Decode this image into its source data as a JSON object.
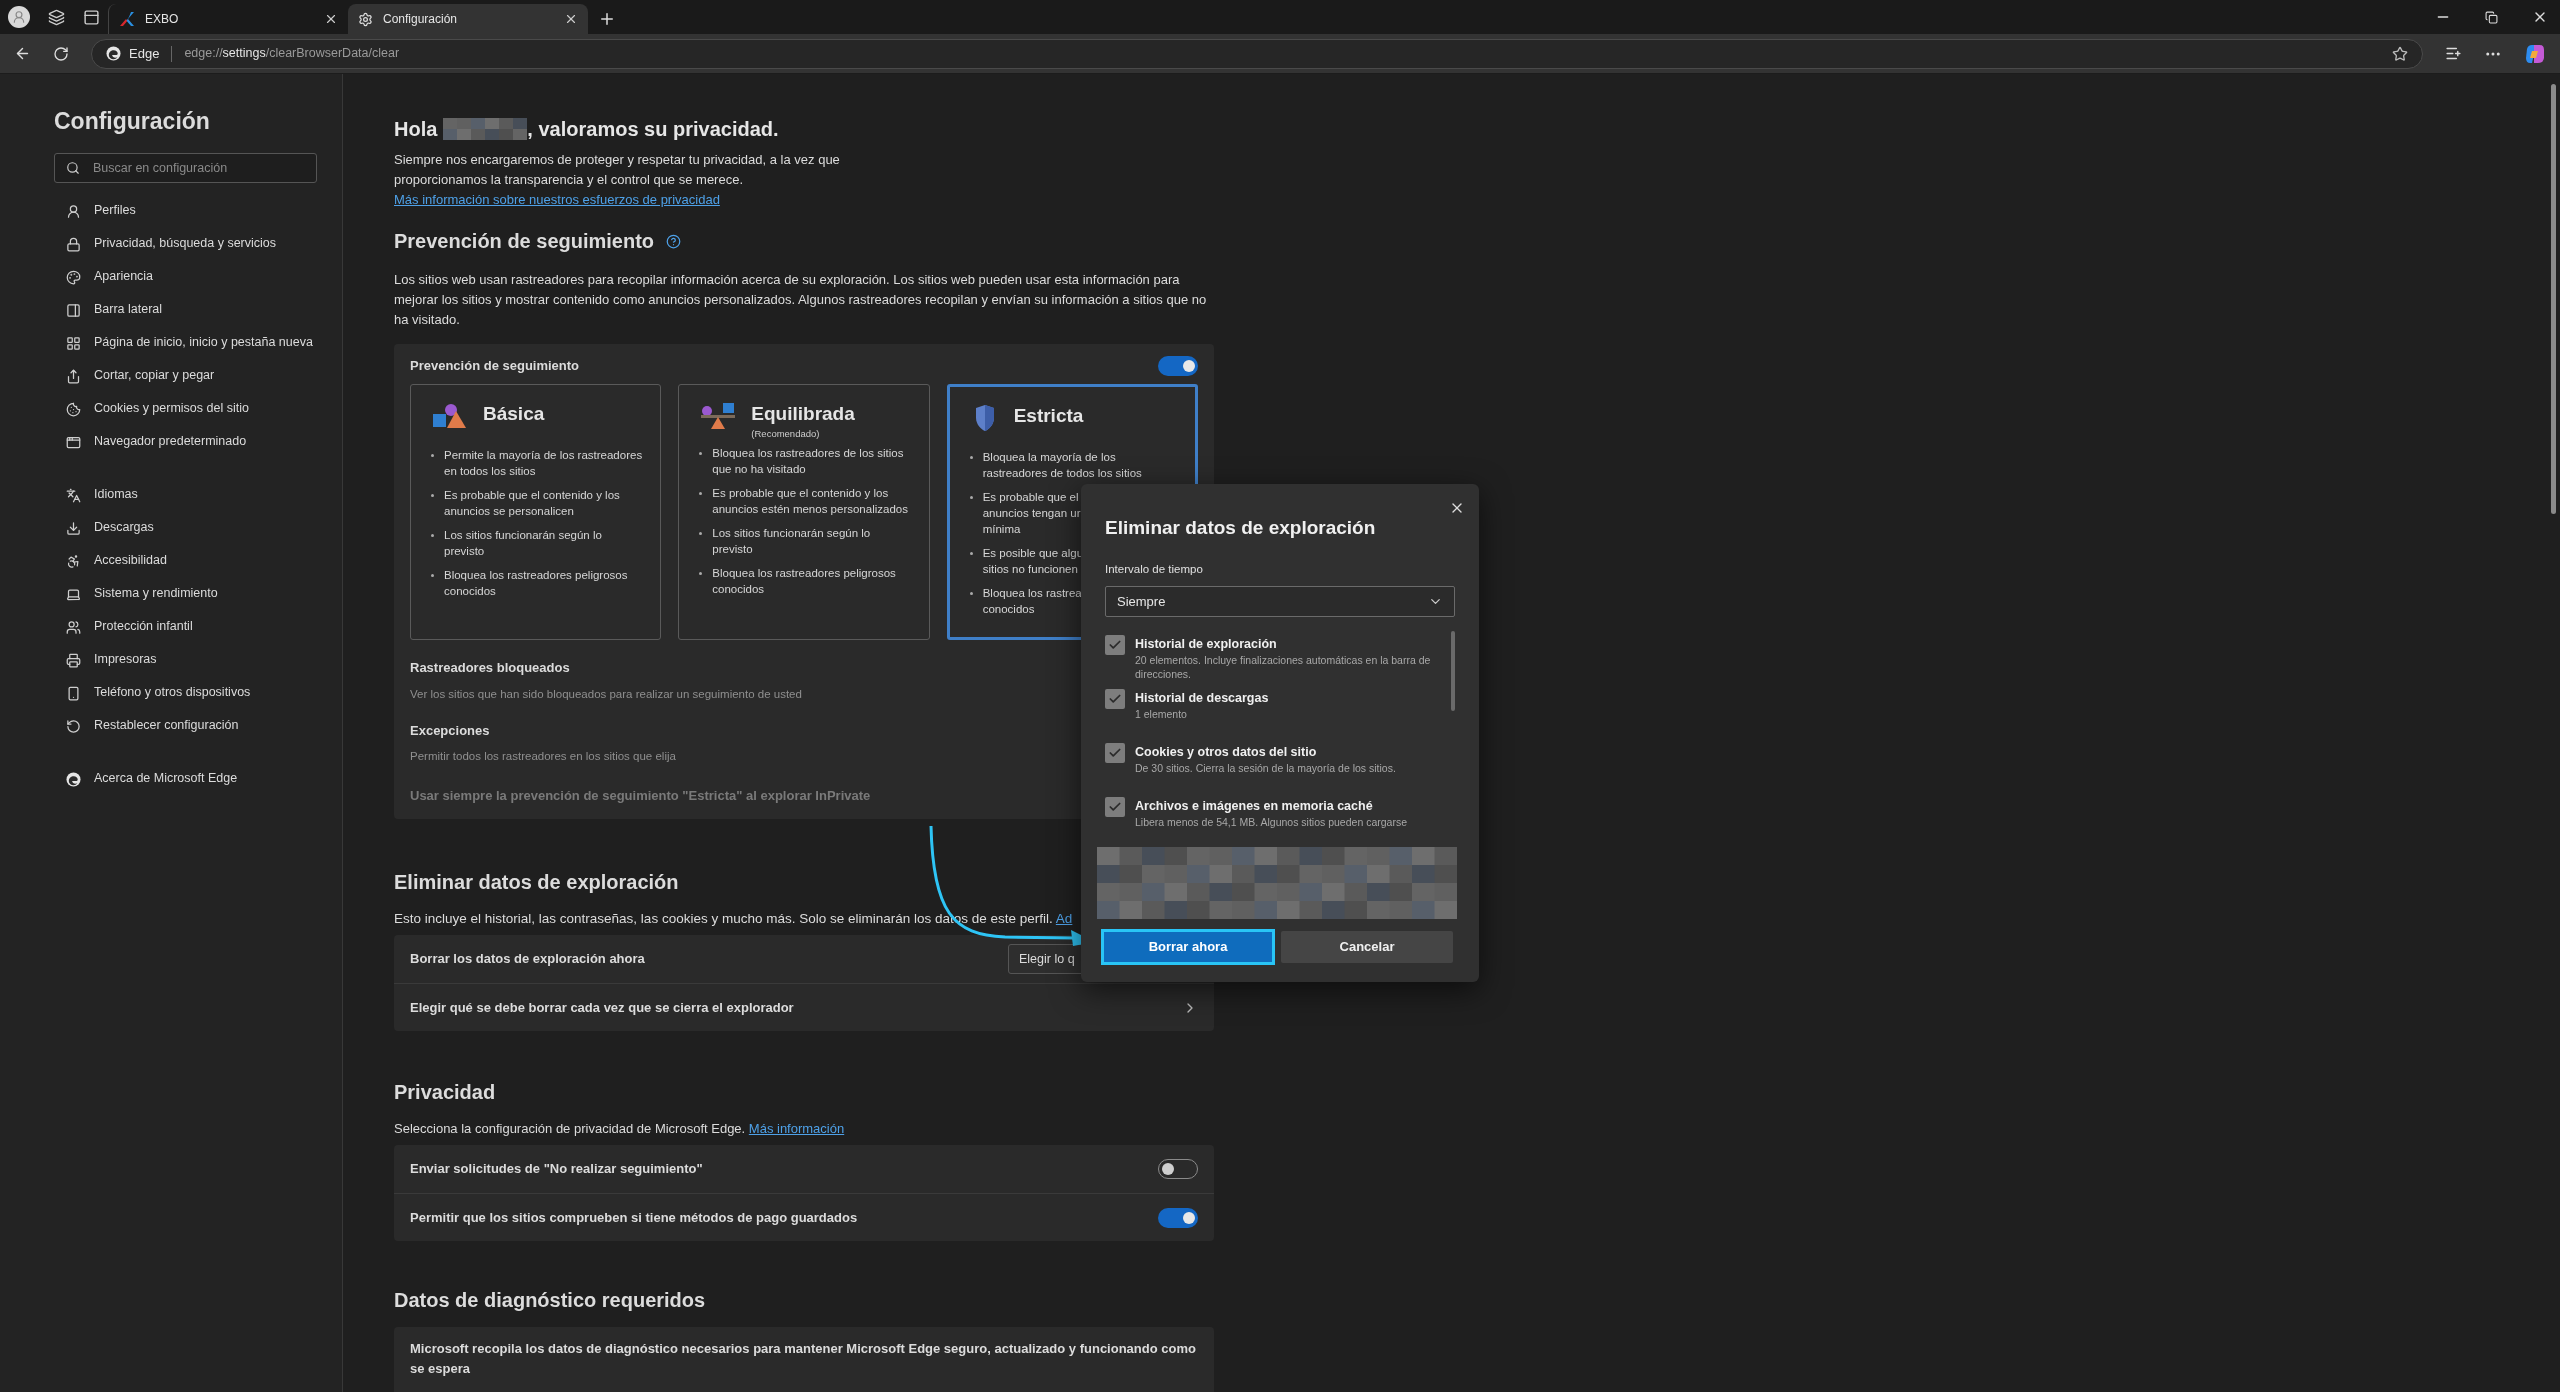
{
  "browser": {
    "tabs": [
      {
        "title": "EXBO",
        "selected": false
      },
      {
        "title": "Configuración",
        "selected": true
      }
    ],
    "address": {
      "label": "Edge",
      "scheme": "edge://",
      "host": "settings",
      "path": "/clearBrowserData/clear"
    }
  },
  "sidebar": {
    "title": "Configuración",
    "search": {
      "placeholder": "Buscar en configuración"
    },
    "groups": [
      [
        "Perfiles",
        "Privacidad, búsqueda y servicios",
        "Apariencia",
        "Barra lateral",
        "Página de inicio, inicio y pestaña nueva",
        "Cortar, copiar y pegar",
        "Cookies y permisos del sitio",
        "Navegador predeterminado"
      ],
      [
        "Idiomas",
        "Descargas",
        "Accesibilidad",
        "Sistema y rendimiento",
        "Protección infantil",
        "Impresoras",
        "Teléfono y otros dispositivos",
        "Restablecer configuración"
      ],
      [
        "Acerca de Microsoft Edge"
      ]
    ]
  },
  "greeting": {
    "before": "Hola",
    "after": ", valoramos su privacidad.",
    "text": "Siempre nos encargaremos de proteger y respetar tu privacidad, a la vez que proporcionamos la transparencia y el control que se merece.",
    "link": "Más información sobre nuestros esfuerzos de privacidad"
  },
  "tracking": {
    "title": "Prevención de seguimiento",
    "description": "Los sitios web usan rastreadores para recopilar información acerca de su exploración. Los sitios web pueden usar esta información para mejorar los sitios y mostrar contenido como anuncios personalizados. Algunos rastreadores recopilan y envían su información a sitios que no ha visitado.",
    "panel_label": "Prevención de seguimiento",
    "on": true,
    "levels": [
      {
        "name": "Básica",
        "selected": false,
        "bullets": [
          [
            "Permite la mayoría de los rastreadores",
            "en todos los sitios"
          ],
          [
            "Es probable que el contenido y los",
            "anuncios se personalicen"
          ],
          [
            "Los sitios funcionarán según lo",
            "previsto"
          ],
          [
            "Bloquea los rastreadores peligrosos",
            "conocidos"
          ]
        ]
      },
      {
        "name": "Equilibrada",
        "note": "(Recomendado)",
        "selected": false,
        "bullets": [
          [
            "Bloquea los rastreadores de los sitios",
            "que no ha visitado"
          ],
          [
            "Es probable que el contenido y los",
            "anuncios estén menos personalizados"
          ],
          [
            "Los sitios funcionarán según lo",
            "previsto"
          ],
          [
            "Bloquea los rastreadores peligrosos",
            "conocidos"
          ]
        ]
      },
      {
        "name": "Estricta",
        "selected": true,
        "bullets": [
          [
            "Bloquea la mayoría de los",
            "rastreadores de todos los sitios"
          ],
          [
            "Es probable que el",
            "anuncios tengan ur",
            "mínima"
          ],
          [
            "Es posible que algu",
            "sitios no funcionen"
          ],
          [
            "Bloquea los rastrea",
            "conocidos"
          ]
        ]
      }
    ],
    "blocked": {
      "title": "Rastreadores bloqueados",
      "subtitle": "Ver los sitios que han sido bloqueados para realizar un seguimiento de usted"
    },
    "exceptions": {
      "title": "Excepciones",
      "subtitle": "Permitir todos los rastreadores en los sitios que elija"
    },
    "inprivate": "Usar siempre la prevención de seguimiento \"Estricta\" al explorar InPrivate"
  },
  "clear": {
    "title": "Eliminar datos de exploración",
    "description": "Esto incluye el historial, las contraseñas, las cookies y mucho más. Solo se eliminarán los datos de este perfil.",
    "link": "Ad",
    "rows": [
      {
        "kind": "button",
        "label": "Borrar los datos de exploración ahora",
        "button": "Elegir lo q"
      },
      {
        "kind": "chevron",
        "label": "Elegir qué se debe borrar cada vez que se cierra el explorador"
      }
    ]
  },
  "privacy": {
    "title": "Privacidad",
    "description": "Selecciona la configuración de privacidad de Microsoft Edge.",
    "link": "Más información",
    "rows": [
      {
        "label": "Enviar solicitudes de \"No realizar seguimiento\"",
        "on": false
      },
      {
        "label": "Permitir que los sitios comprueben si tiene métodos de pago guardados",
        "on": true
      }
    ]
  },
  "diagnostics": {
    "title": "Datos de diagnóstico requeridos",
    "text": "Microsoft recopila los datos de diagnóstico necesarios para mantener Microsoft Edge seguro, actualizado y funcionando como se espera"
  },
  "dialog": {
    "title": "Eliminar datos de exploración",
    "interval_label": "Intervalo de tiempo",
    "interval": "Siempre",
    "items": [
      {
        "label": "Historial de exploración",
        "detail": "20 elementos. Incluye finalizaciones automáticas en la barra de direcciones.",
        "checked": true
      },
      {
        "label": "Historial de descargas",
        "detail": "1 elemento",
        "checked": true
      },
      {
        "label": "Cookies y otros datos del sitio",
        "detail": "De 30 sitios. Cierra la sesión de la mayoría de los sitios.",
        "checked": true
      },
      {
        "label": "Archivos e imágenes en memoria caché",
        "detail": "Libera menos de 54,1 MB. Algunos sitios pueden cargarse",
        "checked": true
      }
    ],
    "primary": "Borrar ahora",
    "secondary": "Cancelar"
  }
}
